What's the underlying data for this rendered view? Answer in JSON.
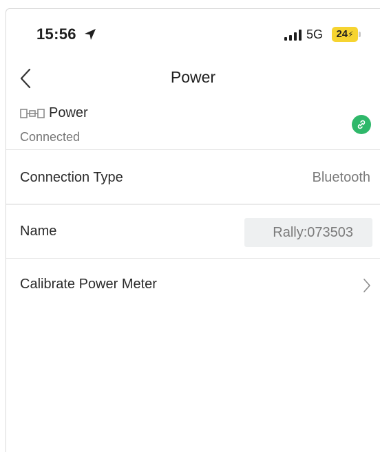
{
  "status_bar": {
    "time": "15:56",
    "network": "5G",
    "battery": "24"
  },
  "nav": {
    "title": "Power"
  },
  "device": {
    "name": "Power",
    "status": "Connected",
    "icon": "power-meter-icon",
    "link_icon": "link-icon"
  },
  "rows": {
    "connection_type": {
      "label": "Connection Type",
      "value": "Bluetooth"
    },
    "name": {
      "label": "Name",
      "value": "Rally:073503"
    },
    "calibrate": {
      "label": "Calibrate Power Meter"
    }
  },
  "colors": {
    "accent_green": "#2fb86a",
    "battery_yellow": "#f6d431",
    "field_bg": "#eef0f1"
  }
}
